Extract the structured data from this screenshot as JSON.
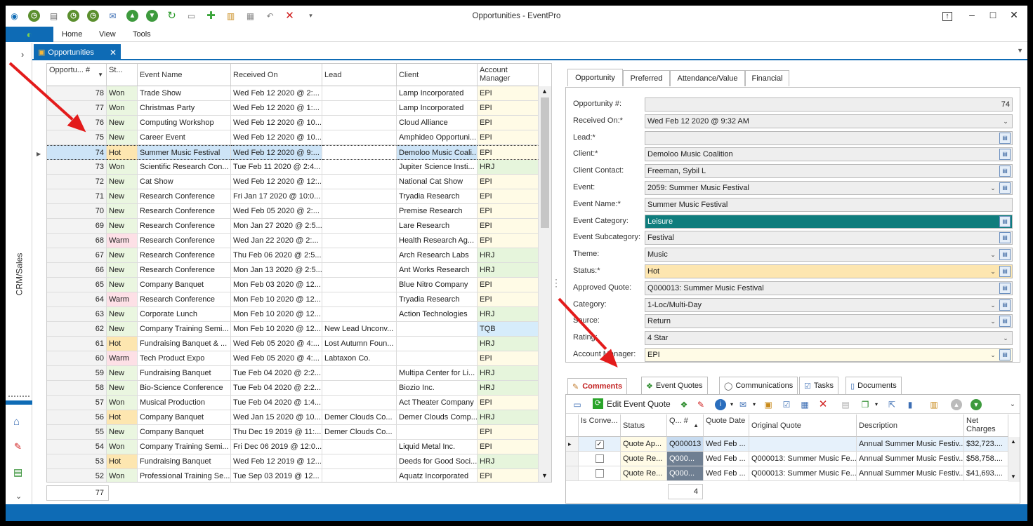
{
  "window": {
    "title": "Opportunities - EventPro"
  },
  "ribbon": {
    "tabs": [
      "Home",
      "View",
      "Tools"
    ]
  },
  "nav": {
    "vertical_label": "CRM/Sales"
  },
  "doc_tab": {
    "label": "Opportunities"
  },
  "grid": {
    "columns": [
      "Opportu... #",
      "St...",
      "Event Name",
      "Received On",
      "Lead",
      "Client",
      "Account Manager"
    ],
    "rows": [
      [
        "78",
        "Won",
        "Trade Show",
        "Wed Feb 12 2020 @ 2:...",
        "",
        "Lamp Incorporated",
        "EPI"
      ],
      [
        "77",
        "Won",
        "Christmas Party",
        "Wed Feb 12 2020 @ 1:...",
        "",
        "Lamp Incorporated",
        "EPI"
      ],
      [
        "76",
        "New",
        "Computing Workshop",
        "Wed Feb 12 2020 @ 10...",
        "",
        "Cloud Alliance",
        "EPI"
      ],
      [
        "75",
        "New",
        "Career Event",
        "Wed Feb 12 2020 @ 10...",
        "",
        "Amphideo Opportuni...",
        "EPI"
      ],
      [
        "74",
        "Hot",
        "Summer Music Festival",
        "Wed Feb 12 2020 @ 9:...",
        "",
        "Demoloo Music Coali...",
        "EPI"
      ],
      [
        "73",
        "Won",
        "Scientific Research Con...",
        "Tue Feb 11 2020 @ 2:4...",
        "",
        "Jupiter Science Insti...",
        "HRJ"
      ],
      [
        "72",
        "New",
        "Cat Show",
        "Wed Feb 12 2020 @ 12:...",
        "",
        "National Cat Show",
        "EPI"
      ],
      [
        "71",
        "New",
        "Research Conference",
        "Fri Jan 17 2020 @ 10:0...",
        "",
        "Tryadia Research",
        "EPI"
      ],
      [
        "70",
        "New",
        "Research Conference",
        "Wed Feb 05 2020 @ 2:...",
        "",
        "Premise Research",
        "EPI"
      ],
      [
        "69",
        "New",
        "Research Conference",
        "Mon Jan 27 2020 @ 2:5...",
        "",
        "Lare Research",
        "EPI"
      ],
      [
        "68",
        "Warm",
        "Research Conference",
        "Wed Jan 22 2020 @ 2:...",
        "",
        "Health Research Ag...",
        "EPI"
      ],
      [
        "67",
        "New",
        "Research Conference",
        "Thu Feb 06 2020 @ 2:5...",
        "",
        "Arch Research Labs",
        "HRJ"
      ],
      [
        "66",
        "New",
        "Research Conference",
        "Mon Jan 13 2020 @ 2:5...",
        "",
        "Ant Works Research",
        "HRJ"
      ],
      [
        "65",
        "New",
        "Company Banquet",
        "Mon Feb 03 2020 @ 12...",
        "",
        "Blue Nitro Company",
        "EPI"
      ],
      [
        "64",
        "Warm",
        "Research Conference",
        "Mon Feb 10 2020 @ 12...",
        "",
        "Tryadia Research",
        "EPI"
      ],
      [
        "63",
        "New",
        "Corporate Lunch",
        "Mon Feb 10 2020 @ 12...",
        "",
        "Action Technologies",
        "HRJ"
      ],
      [
        "62",
        "New",
        "Company Training Semi...",
        "Mon Feb 10 2020 @ 12...",
        "New Lead Unconv...",
        "",
        "TQB"
      ],
      [
        "61",
        "Hot",
        "Fundraising Banquet & ...",
        "Wed Feb 05 2020 @ 4:...",
        "Lost Autumn Foun...",
        "",
        "HRJ"
      ],
      [
        "60",
        "Warm",
        "Tech Product Expo",
        "Wed Feb 05 2020 @ 4:...",
        "Labtaxon Co.",
        "",
        "EPI"
      ],
      [
        "59",
        "New",
        "Fundraising Banquet",
        "Tue Feb 04 2020 @ 2:2...",
        "",
        "Multipa Center for Li...",
        "HRJ"
      ],
      [
        "58",
        "New",
        "Bio-Science Conference",
        "Tue Feb 04 2020 @ 2:2...",
        "",
        "Biozio Inc.",
        "HRJ"
      ],
      [
        "57",
        "Won",
        "Musical Production",
        "Tue Feb 04 2020 @ 1:4...",
        "",
        "Act Theater Company",
        "EPI"
      ],
      [
        "56",
        "Hot",
        "Company Banquet",
        "Wed Jan 15 2020 @ 10...",
        "Demer Clouds Co...",
        "Demer Clouds Comp...",
        "HRJ"
      ],
      [
        "55",
        "New",
        "Company Banquet",
        "Thu Dec 19 2019 @ 11:...",
        "Demer Clouds Co...",
        "",
        "EPI"
      ],
      [
        "54",
        "Won",
        "Company Training Semi...",
        "Fri Dec 06 2019 @ 12:0...",
        "",
        "Liquid Metal Inc.",
        "EPI"
      ],
      [
        "53",
        "Hot",
        "Fundraising Banquet",
        "Wed Feb 12 2019 @ 12...",
        "",
        "Deeds for Good Soci...",
        "HRJ"
      ],
      [
        "52",
        "Won",
        "Professional Training Se...",
        "Tue Sep 03 2019 @ 12...",
        "",
        "Aquatz Incorporated",
        "EPI"
      ]
    ],
    "footer_count": "77",
    "colors": {
      "Won": "#eaf6e0",
      "New": "#eaf6e0",
      "Hot": "#fde6b0",
      "Warm": "#fde0e6",
      "EPI": "#fffbe6",
      "HRJ": "#e6f5dc",
      "TQB": "#d6ecfb",
      "selected": "#cde4f7"
    }
  },
  "detail": {
    "tabs": [
      "Opportunity",
      "Preferred",
      "Attendance/Value",
      "Financial"
    ],
    "fields": [
      {
        "label": "Opportunity #:",
        "value": "74",
        "kind": "num"
      },
      {
        "label": "Received On:*",
        "value": "Wed Feb 12 2020 @ 9:32 AM",
        "kind": "drop"
      },
      {
        "label": "Lead:*",
        "value": "",
        "kind": "btn"
      },
      {
        "label": "Client:*",
        "value": "Demoloo Music Coalition",
        "kind": "btn"
      },
      {
        "label": "Client Contact:",
        "value": "Freeman, Sybil L",
        "kind": "btn"
      },
      {
        "label": "Event:",
        "value": "2059: Summer Music Festival",
        "kind": "dropbtn"
      },
      {
        "label": "Event Name:*",
        "value": "Summer Music Festival",
        "kind": "plain"
      },
      {
        "label": "Event Category:",
        "value": "Leisure",
        "kind": "btn",
        "color": "#0f7d7d"
      },
      {
        "label": "Event Subcategory:",
        "value": "Festival",
        "kind": "btn"
      },
      {
        "label": "Theme:",
        "value": "Music",
        "kind": "dropbtn"
      },
      {
        "label": "Status:*",
        "value": "Hot",
        "kind": "dropbtn",
        "color": "#fde6b0"
      },
      {
        "label": "Approved Quote:",
        "value": "Q000013: Summer Music Festival",
        "kind": "btn"
      },
      {
        "label": "Category:",
        "value": "1-Loc/Multi-Day",
        "kind": "dropbtn"
      },
      {
        "label": "Source:",
        "value": "Return",
        "kind": "dropbtn"
      },
      {
        "label": "Rating:",
        "value": "4 Star",
        "kind": "drop"
      },
      {
        "label": "Account Manager:",
        "value": "EPI",
        "kind": "dropbtn",
        "color": "#fffbe6"
      }
    ]
  },
  "bottom": {
    "tabs": [
      "Comments",
      "Event Quotes",
      "Communications",
      "Tasks",
      "Documents"
    ],
    "edit_button": "Edit Event Quote",
    "columns": [
      "Is Conve...",
      "Status",
      "Q... #",
      "Quote Date",
      "Original Quote",
      "Description",
      "Net Charges"
    ],
    "rows": [
      {
        "checked": true,
        "status": "Quote Ap...",
        "num": "Q000013",
        "date": "Wed Feb ...",
        "orig": "",
        "desc": "Annual Summer Music Festiv...",
        "net": "$32,723...."
      },
      {
        "checked": false,
        "status": "Quote Re...",
        "num": "Q000...",
        "date": "Wed Feb ...",
        "orig": "Q000013: Summer Music Fe...",
        "desc": "Annual Summer Music Festiv...",
        "net": "$58,758...."
      },
      {
        "checked": false,
        "status": "Quote Re...",
        "num": "Q000...",
        "date": "Wed Feb ...",
        "orig": "Q000013: Summer Music Fe...",
        "desc": "Annual Summer Music Festiv...",
        "net": "$41,693...."
      }
    ],
    "footer_count": "4"
  }
}
